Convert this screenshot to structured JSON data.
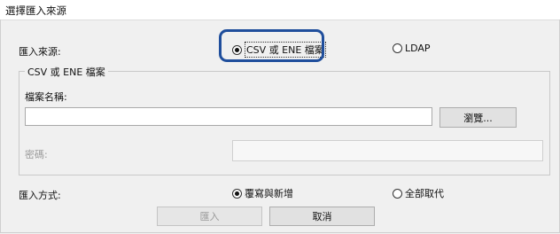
{
  "window": {
    "title": "選擇匯入來源"
  },
  "import_source": {
    "label": "匯入來源:",
    "options": [
      {
        "label": "CSV 或 ENE 檔案",
        "selected": true
      },
      {
        "label": "LDAP",
        "selected": false
      }
    ]
  },
  "file_group": {
    "title": "CSV 或 ENE 檔案",
    "filename_label": "檔案名稱:",
    "filename_value": "",
    "browse_label": "瀏覽...",
    "password_label": "密碼:",
    "password_value": ""
  },
  "import_method": {
    "label": "匯入方式:",
    "options": [
      {
        "label": "覆寫與新增",
        "selected": true
      },
      {
        "label": "全部取代",
        "selected": false
      }
    ]
  },
  "buttons": {
    "import_label": "匯入",
    "cancel_label": "取消"
  },
  "colors": {
    "highlight": "#1f4e9c",
    "background": "#f0f0f0"
  }
}
